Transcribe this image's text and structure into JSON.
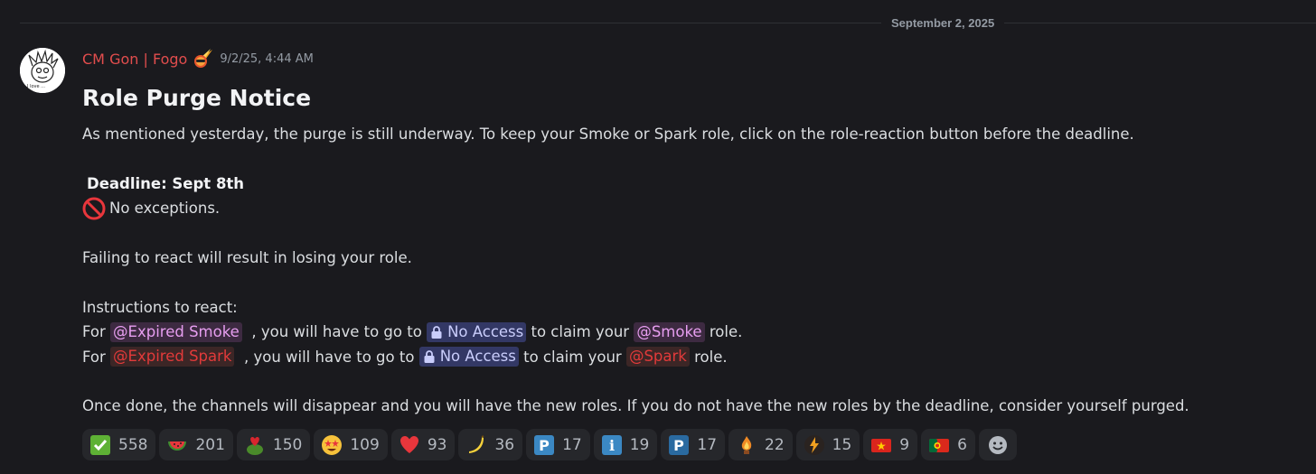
{
  "divider": {
    "date": "September 2, 2025"
  },
  "message": {
    "username": "CM Gon | Fogo",
    "timestamp": "9/2/25, 4:44 AM",
    "heading": "Role Purge Notice",
    "intro": "As mentioned yesterday, the purge is still underway. To keep your Smoke or Spark role, click on the role-reaction button before the deadline.",
    "deadline": "Deadline: Sept 8th",
    "no_exceptions": "No exceptions.",
    "failing": "Failing to react will result in losing your role.",
    "instructions_title": "Instructions to react:",
    "line1": {
      "prefix": "For",
      "role": "@Expired Smoke",
      "middle": ", you will have to go to",
      "channel": "No Access",
      "after": "to claim your",
      "new_role": "@Smoke",
      "suffix": "role."
    },
    "line2": {
      "prefix": "For",
      "role": "@Expired Spark",
      "middle": ", you will have to go to",
      "channel": "No Access",
      "after": "to claim your",
      "new_role": "@Spark",
      "suffix": "role."
    },
    "closing": "Once done, the channels will disappear and you will have the new roles. If you do not have the new roles by the deadline, consider yourself purged."
  },
  "reactions": [
    {
      "icon": "check-mark-icon",
      "count": "558"
    },
    {
      "icon": "watermelon-icon",
      "count": "201"
    },
    {
      "icon": "frog-heart-icon",
      "count": "150"
    },
    {
      "icon": "star-struck-icon",
      "count": "109"
    },
    {
      "icon": "red-heart-icon",
      "count": "93"
    },
    {
      "icon": "banana-icon",
      "count": "36"
    },
    {
      "icon": "p-button-icon",
      "count": "17"
    },
    {
      "icon": "info-icon",
      "count": "19"
    },
    {
      "icon": "p-button-icon",
      "count": "17"
    },
    {
      "icon": "fire-figure-icon",
      "count": "22"
    },
    {
      "icon": "lightning-icon",
      "count": "15"
    },
    {
      "icon": "vietnam-flag-icon",
      "count": "9"
    },
    {
      "icon": "portugal-flag-icon",
      "count": "6"
    }
  ],
  "colors": {
    "username": "#e24d4d",
    "smoke_mention": "#e79ef0",
    "spark_mention": "#e23a3a",
    "channel_mention": "#c9cdfb"
  }
}
